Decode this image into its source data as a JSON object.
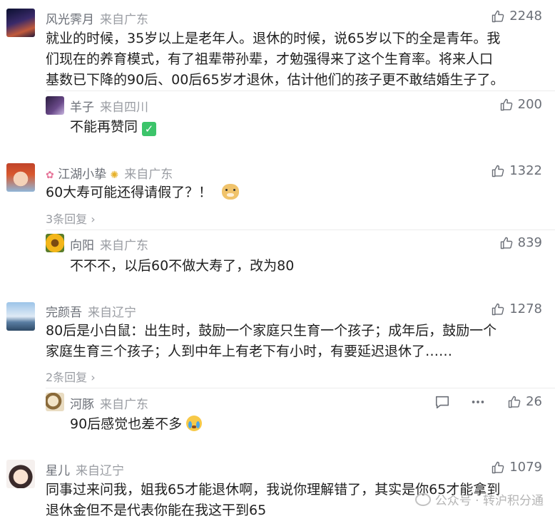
{
  "comments": [
    {
      "user": "风光霁月",
      "location": "来自广东",
      "likes": "2248",
      "lines": [
        "就业的时候，35岁以上是老年人。退休的时候，说65岁以下的全是青年。我",
        "们现在的养育模式，有了祖辈带孙辈，才勉强得来了这个生育率。将来人口",
        "基数已下降的90后、00后65岁才退休，估计他们的孩子更不敢结婚生子了。"
      ],
      "reply": {
        "user": "羊子",
        "location": "来自四川",
        "likes": "200",
        "text": "不能再赞同",
        "emoji": "✅"
      }
    },
    {
      "user": "江湖小挚",
      "name_prefix_emoji": "🌷",
      "name_suffix_emoji": "🌻",
      "location": "来自广东",
      "likes": "1322",
      "lines": [
        "60大寿可能还得请假了？！"
      ],
      "emoji": "🐶",
      "more_replies": "3条回复",
      "reply": {
        "user": "向阳",
        "location": "来自广东",
        "likes": "839",
        "text": "不不不，以后60不做大寿了，改为80"
      }
    },
    {
      "user": "完颜吾",
      "location": "来自辽宁",
      "likes": "1278",
      "lines": [
        "80后是小白鼠：出生时，鼓励一个家庭只生育一个孩子；成年后，鼓励一个",
        "家庭生育三个孩子；人到中年上有老下有小时，有要延迟退休了……"
      ],
      "more_replies": "2条回复",
      "reply": {
        "user": "河豚",
        "location": "来自广东",
        "likes": "26",
        "text": "90后感觉也差不多",
        "emoji": "😭"
      }
    },
    {
      "user": "星儿",
      "location": "来自辽宁",
      "likes": "1079",
      "lines": [
        "同事过来问我，姐我65才能退休啊，我说你理解错了，其实是你65才能拿到",
        "退休金但不是代表你能在我这干到65"
      ]
    }
  ],
  "watermark": "公众号 · 转沪积分通",
  "icons": [
    "thumbs-up-icon",
    "comment-icon",
    "more-icon"
  ]
}
